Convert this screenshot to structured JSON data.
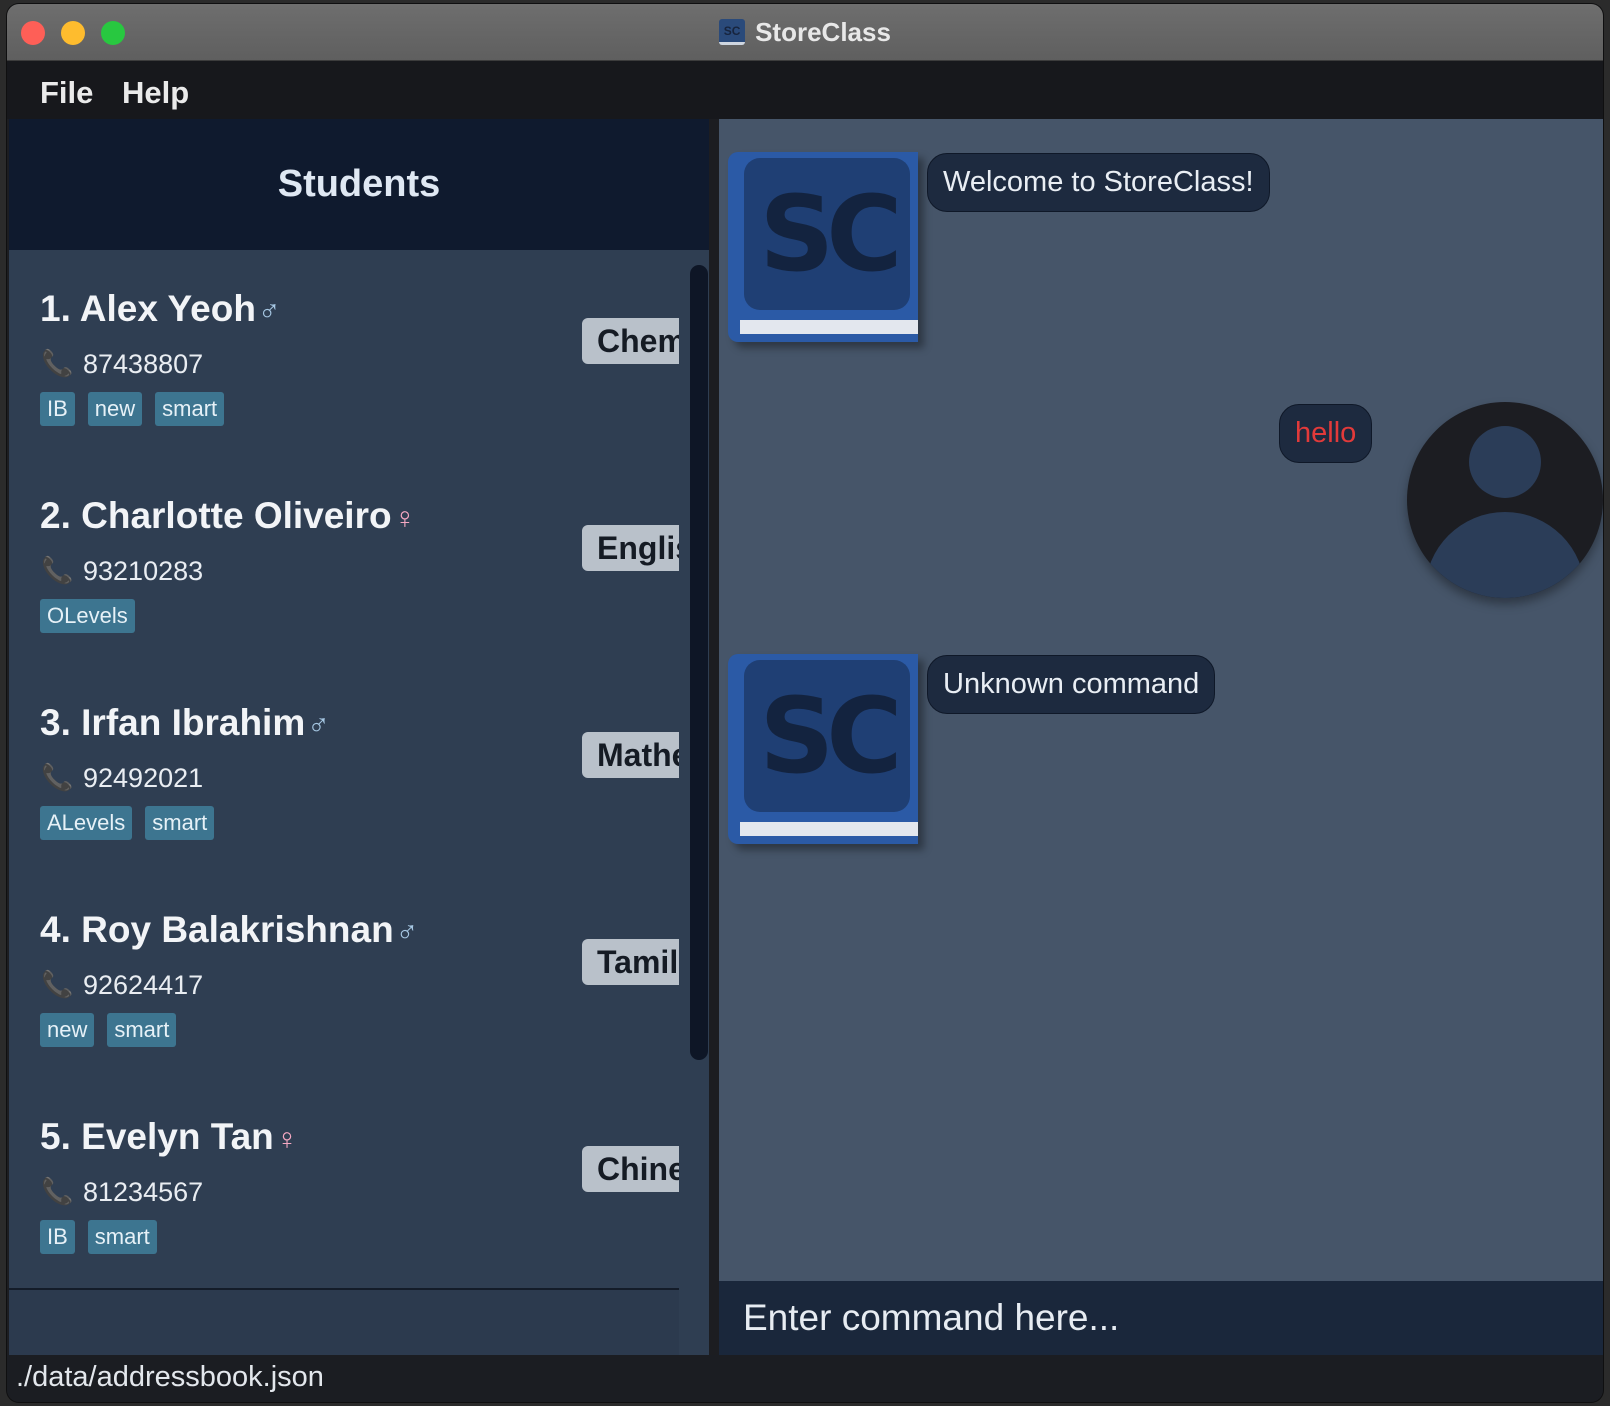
{
  "window": {
    "title": "StoreClass",
    "app_icon": "storeclass-logo-icon"
  },
  "menu": [
    {
      "label": "File"
    },
    {
      "label": "Help"
    }
  ],
  "students_panel": {
    "header": "Students",
    "students": [
      {
        "name": "1. Alex Yeoh",
        "gender": "♂",
        "phone_icon": "📞",
        "phone": "87438807",
        "tags": [
          "IB",
          "new",
          "smart"
        ],
        "subject": "Chemi"
      },
      {
        "name": "2. Charlotte Oliveiro",
        "gender": "♀",
        "phone_icon": "📞",
        "phone": "93210283",
        "tags": [
          "OLevels"
        ],
        "subject": "English"
      },
      {
        "name": "3. Irfan Ibrahim",
        "gender": "♂",
        "phone_icon": "📞",
        "phone": "92492021",
        "tags": [
          "ALevels",
          "smart"
        ],
        "subject": "Mathe"
      },
      {
        "name": "4. Roy Balakrishnan",
        "gender": "♂",
        "phone_icon": "📞",
        "phone": "92624417",
        "tags": [
          "new",
          "smart"
        ],
        "subject": "Tamil"
      },
      {
        "name": "5. Evelyn Tan",
        "gender": "♀",
        "phone_icon": "📞",
        "phone": "81234567",
        "tags": [
          "IB",
          "smart"
        ],
        "subject": "Chines"
      }
    ]
  },
  "chat": {
    "bot_avatar_text": "SC",
    "messages": [
      {
        "from": "bot",
        "text": "Welcome to StoreClass!"
      },
      {
        "from": "user",
        "text": "hello"
      },
      {
        "from": "bot",
        "text": "Unknown command"
      }
    ]
  },
  "command_box": {
    "placeholder": "Enter command here..."
  },
  "status_bar": {
    "path": "./data/addressbook.json"
  },
  "colors": {
    "accent_tag": "#3d7590",
    "error_text": "#e23a3a",
    "panel_dark": "#0f1a2e",
    "chat_bg": "#465569",
    "male_symbol": "#a7c8e4",
    "female_symbol": "#f5a8c2"
  }
}
